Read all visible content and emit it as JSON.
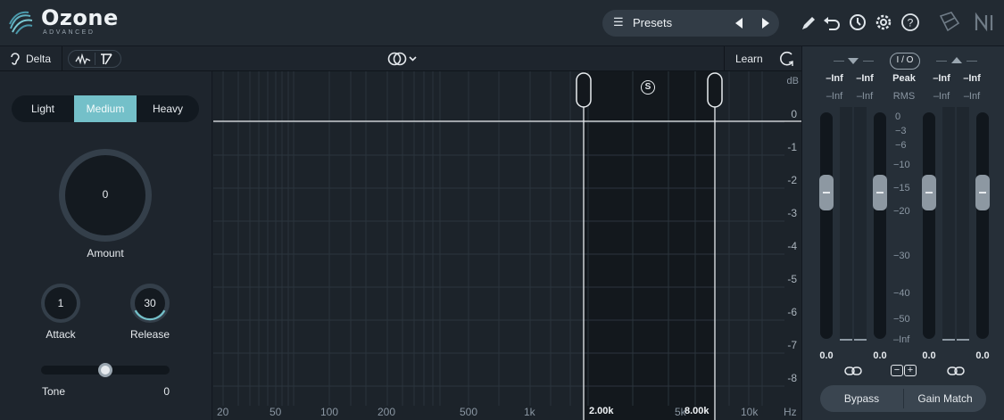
{
  "app": {
    "name": "Ozone",
    "edition": "ADVANCED"
  },
  "header": {
    "presets_label": "Presets"
  },
  "toolbar": {
    "delta_label": "Delta",
    "learn_label": "Learn"
  },
  "module": {
    "modes": [
      "Light",
      "Medium",
      "Heavy"
    ],
    "active_mode": "Medium",
    "amount": {
      "label": "Amount",
      "value": "0"
    },
    "attack": {
      "label": "Attack",
      "value": "1"
    },
    "release": {
      "label": "Release",
      "value": "30"
    },
    "tone": {
      "label": "Tone",
      "value": "0",
      "level": 0.5
    }
  },
  "graph": {
    "db_unit": "dB",
    "db_ticks": [
      "0",
      "-1",
      "-2",
      "-3",
      "-4",
      "-5",
      "-6",
      "-7",
      "-8"
    ],
    "freq_ticks": [
      "20",
      "50",
      "100",
      "200",
      "500",
      "1k",
      "5k",
      "10k",
      "Hz"
    ],
    "band_low": "2.00k",
    "band_high": "8.00k",
    "solo_label": "S"
  },
  "meters": {
    "io_label": "I / O",
    "peak_label": "Peak",
    "rms_label": "RMS",
    "input_peak": [
      "–Inf",
      "–Inf"
    ],
    "input_rms": [
      "–Inf",
      "–Inf"
    ],
    "output_peak": [
      "–Inf",
      "–Inf"
    ],
    "output_rms": [
      "–Inf",
      "–Inf"
    ],
    "scale": [
      "0",
      "−3",
      "−6",
      "−10",
      "−15",
      "−20",
      "−30",
      "−40",
      "−50",
      "–Inf"
    ],
    "fader_values": [
      "0.0",
      "0.0",
      "0.0",
      "0.0"
    ],
    "bypass_label": "Bypass",
    "gain_match_label": "Gain Match"
  },
  "colors": {
    "accent": "#74c0c9",
    "background": "#1b2229"
  }
}
